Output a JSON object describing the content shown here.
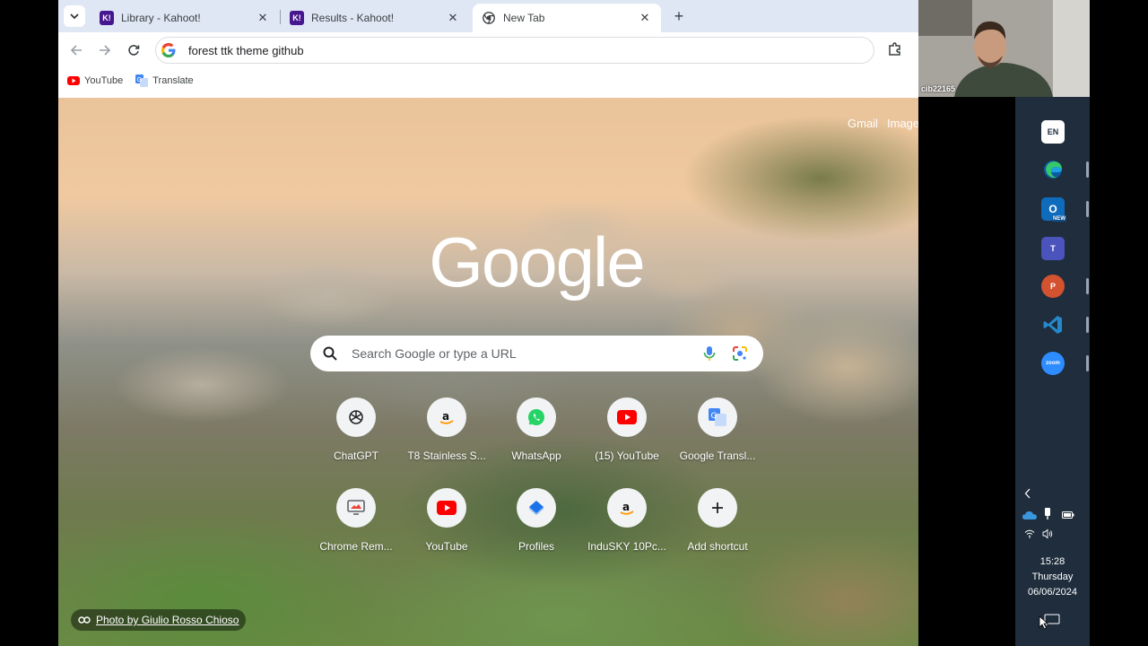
{
  "tabs": [
    {
      "title": "Library - Kahoot!",
      "favicon": "kahoot-icon",
      "active": false
    },
    {
      "title": "Results - Kahoot!",
      "favicon": "kahoot-icon",
      "active": false
    },
    {
      "title": "New Tab",
      "favicon": "chrome-icon",
      "active": true
    }
  ],
  "omnibox": {
    "value": "forest ttk theme github"
  },
  "bookmarks": [
    {
      "label": "YouTube",
      "icon": "youtube-icon"
    },
    {
      "label": "Translate",
      "icon": "translate-icon"
    }
  ],
  "ntp": {
    "links": {
      "gmail": "Gmail",
      "images": "Images"
    },
    "logo": "Google",
    "search_placeholder": "Search Google or type a URL",
    "shortcuts": [
      {
        "label": "ChatGPT",
        "icon": "chatgpt-icon"
      },
      {
        "label": "T8 Stainless S...",
        "icon": "amazon-icon"
      },
      {
        "label": "WhatsApp",
        "icon": "whatsapp-icon"
      },
      {
        "label": "(15) YouTube",
        "icon": "youtube-icon"
      },
      {
        "label": "Google Transl...",
        "icon": "translate-icon"
      },
      {
        "label": "Chrome Rem...",
        "icon": "remote-desktop-icon"
      },
      {
        "label": "YouTube",
        "icon": "youtube-icon"
      },
      {
        "label": "Profiles",
        "icon": "profiles-icon"
      },
      {
        "label": "InduSKY 10Pc...",
        "icon": "amazon-icon"
      },
      {
        "label": "Add shortcut",
        "icon": "plus-icon"
      }
    ],
    "photo_credit": "Photo by Giulio Rosso Chioso"
  },
  "webcam": {
    "name": "cib22165"
  },
  "taskbar": {
    "apps": [
      {
        "name": "language-indicator",
        "text": "EN"
      },
      {
        "name": "edge-icon",
        "text": ""
      },
      {
        "name": "outlook-icon",
        "text": "NEW"
      },
      {
        "name": "teams-icon",
        "text": "T"
      },
      {
        "name": "powerpoint-icon",
        "text": "P"
      },
      {
        "name": "vscode-icon",
        "text": ""
      },
      {
        "name": "zoom-icon",
        "text": "zoom"
      }
    ],
    "time": "15:28",
    "day": "Thursday",
    "date": "06/06/2024"
  },
  "colors": {
    "tabstrip": "#dfe7f5",
    "taskbar": "#1f2d3d",
    "kahoot": "#46178f",
    "youtube_red": "#ff0000"
  }
}
